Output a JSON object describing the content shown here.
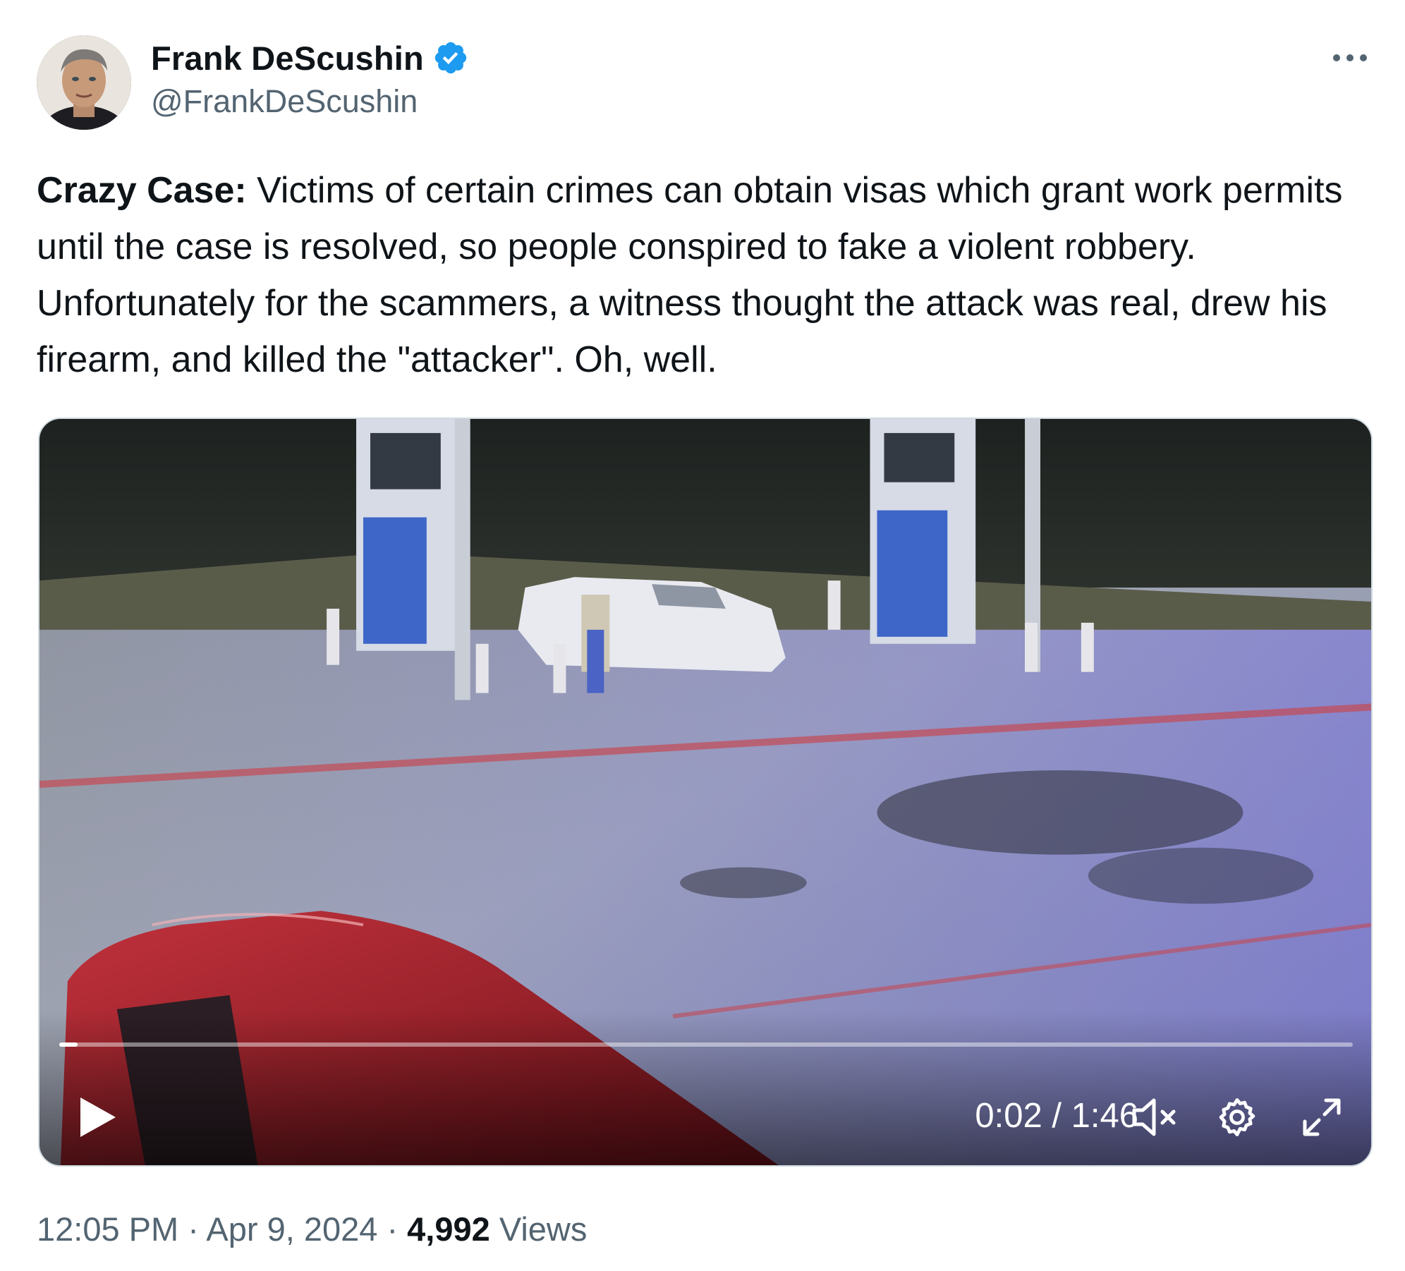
{
  "author": {
    "display_name": "Frank DeScushin",
    "handle": "@FrankDeScushin",
    "verified": true,
    "verified_icon": "verified-badge-icon"
  },
  "more_icon": "more-horizontal-icon",
  "tweet": {
    "bold_prefix": "Crazy Case:",
    "text": " Victims of certain crimes can obtain visas which grant work permits until the case is resolved, so people conspired to fake a violent robbery. Unfortunately for the scammers, a witness thought the attack was real, drew his firearm, and killed the \"attacker\". Oh, well."
  },
  "video": {
    "time_display": "0:02 / 1:46",
    "progress": 0.014,
    "play_icon": "play-icon",
    "mute_icon": "volume-muted-icon",
    "settings_icon": "gear-icon",
    "fullscreen_icon": "fullscreen-expand-icon"
  },
  "meta": {
    "time": "12:05 PM",
    "separator": " · ",
    "date": "Apr 9, 2024",
    "views_count": "4,992",
    "views_label": " Views"
  },
  "colors": {
    "verified_blue": "#1d9bf0",
    "secondary_text": "#536471",
    "primary_text": "#0f1419",
    "border": "#cfd9de"
  }
}
